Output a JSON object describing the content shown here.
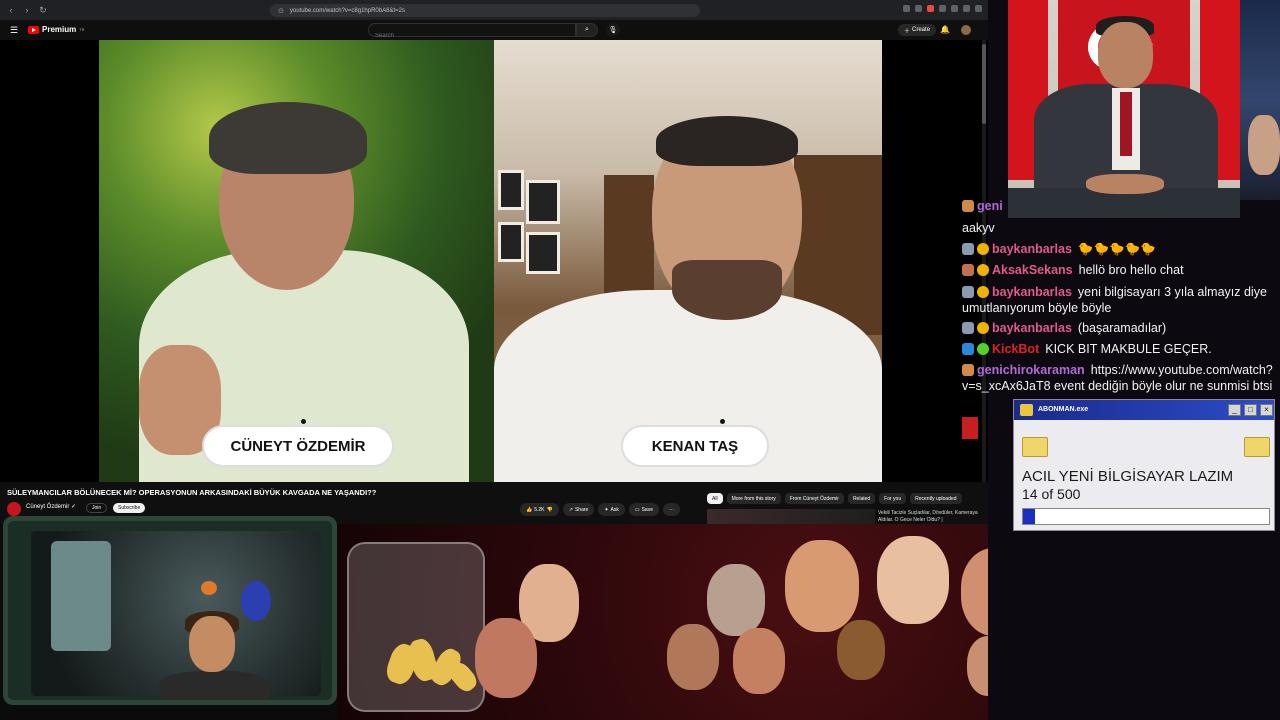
{
  "browser": {
    "url": "youtube.com/watch?v=c8g1hpR0bA8&t=2s"
  },
  "youtube": {
    "brand": "Premium",
    "brand_sup": "TR",
    "search_placeholder": "Search",
    "create_label": "Create"
  },
  "video": {
    "left_name": "CÜNEYT ÖZDEMİR",
    "right_name": "KENAN TAŞ",
    "title": "SÜLEYMANCILAR BÖLÜNECEK Mİ? OPERASYONUN ARKASINDAKİ BÜYÜK KAVGADA NE YAŞANDI??",
    "channel": "Cüneyt Özdemir",
    "join": "Join",
    "subscribe": "Subscribe",
    "likes": "5.2K",
    "share": "Share",
    "ask": "Ask",
    "save": "Save",
    "more": "···"
  },
  "chips": [
    "All",
    "More from this story",
    "From Cüneyt Özdemir",
    "Related",
    "For you",
    "Recently uploaded"
  ],
  "related": {
    "title": "Vekili Tacizle Suçladılar, Dövdüler, Kameraya Aldılar. O Gece Neler Oldu? |"
  },
  "chat": {
    "cut_top": "aakyv",
    "messages": [
      {
        "user": "geni",
        "text": "",
        "color": "#b16ad8"
      },
      {
        "user": "baykanbarlas",
        "text": "🐤🐤🐤🐤🐤",
        "color": "#e05a8a"
      },
      {
        "user": "AksakSekans",
        "text": "hellö bro hello chat",
        "color": "#e05a8a"
      },
      {
        "user": "baykanbarlas",
        "text": "yeni bilgisayarı 3 yıla almayız diye",
        "color": "#e05a8a"
      },
      {
        "user": "baykanbarlas",
        "text": "(başaramadılar)",
        "color": "#e05a8a"
      },
      {
        "user": "KickBot",
        "text": "KICK BIT MAKBULE GEÇER.",
        "color": "#e02222"
      },
      {
        "user": "genichirokaraman",
        "text": "https://www.youtube.com/watch?",
        "color": "#b16ad8"
      }
    ],
    "cont_1": "umutlanıyorum böyle böyle",
    "cont_2": "v=s_xcAx6JaT8 event dediğin böyle olur ne sunmisi btsi"
  },
  "popup": {
    "title": "ABONMAN.exe",
    "heading": "ACIL YENİ BİLGİSAYAR LAZIM",
    "count": "14 of 500",
    "progress": 0.028
  },
  "colors": {
    "accent_red": "#ff0000",
    "progress_blue": "#1a2fc0"
  }
}
